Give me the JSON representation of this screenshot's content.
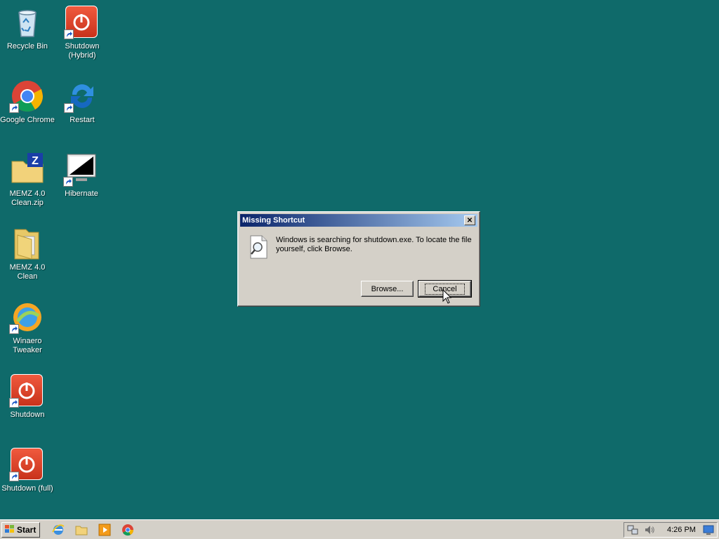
{
  "desktop": {
    "background_color": "#0f6a6a",
    "icons": [
      {
        "label": "Recycle Bin",
        "icon": "recycle-bin-icon"
      },
      {
        "label": "Shutdown\n(Hybrid)",
        "icon": "power-icon"
      },
      {
        "label": "Google Chrome",
        "icon": "chrome-icon"
      },
      {
        "label": "Restart",
        "icon": "restart-icon"
      },
      {
        "label": "MEMZ 4.0\nClean.zip",
        "icon": "zip-folder-icon"
      },
      {
        "label": "Hibernate",
        "icon": "hibernate-icon"
      },
      {
        "label": "MEMZ 4.0\nClean",
        "icon": "folder-icon"
      },
      {
        "label": "Winaero\nTweaker",
        "icon": "winaero-icon"
      },
      {
        "label": "Shutdown",
        "icon": "power-icon"
      },
      {
        "label": "Shutdown (full)",
        "icon": "power-icon"
      }
    ]
  },
  "dialog": {
    "title": "Missing Shortcut",
    "message": "Windows is searching for shutdown.exe. To locate the file yourself, click Browse.",
    "browse_label": "Browse...",
    "cancel_label": "Cancel",
    "close_glyph": "✕"
  },
  "taskbar": {
    "start_label": "Start",
    "quick_launch": [
      "internet-explorer-icon",
      "explorer-icon",
      "media-player-icon",
      "chrome-icon"
    ],
    "clock": "4:26 PM"
  }
}
